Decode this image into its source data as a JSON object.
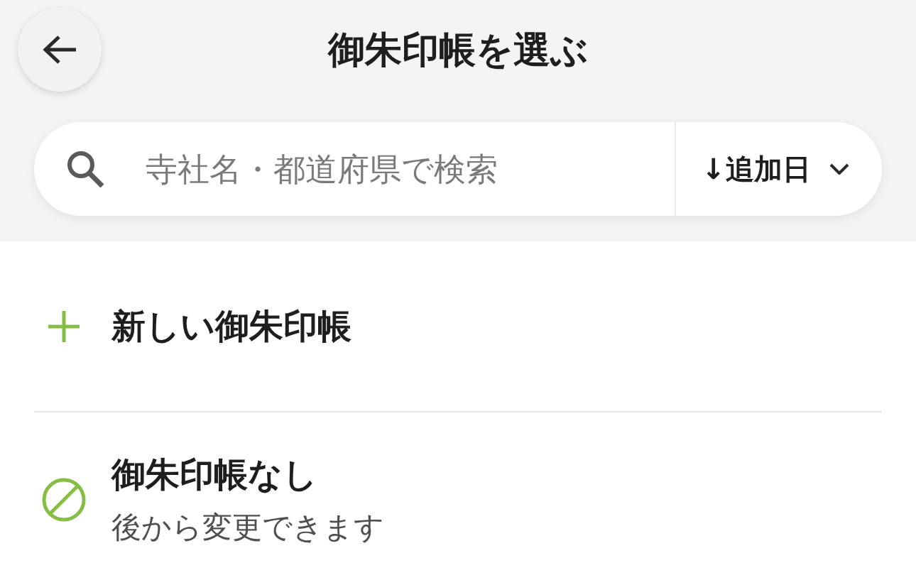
{
  "header": {
    "title": "御朱印帳を選ぶ"
  },
  "search": {
    "placeholder": "寺社名・都道府県で検索"
  },
  "sort": {
    "label": "↓追加日"
  },
  "options": [
    {
      "kind": "new",
      "title": "新しい御朱印帳"
    },
    {
      "kind": "none",
      "title": "御朱印帳なし",
      "subtitle": "後から変更できます"
    }
  ]
}
